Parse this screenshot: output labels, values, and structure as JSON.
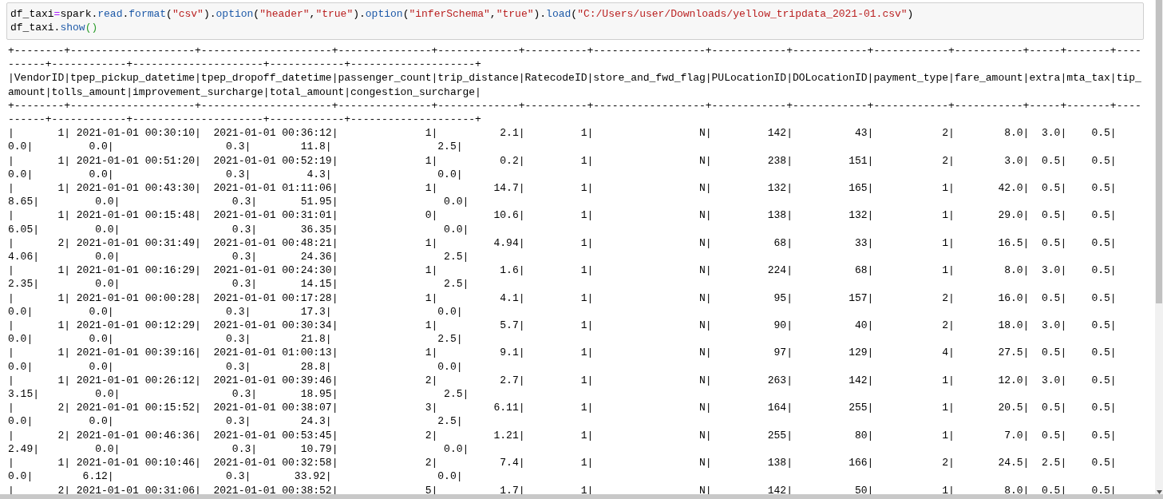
{
  "code": {
    "lines": [
      [
        {
          "kind": "variable",
          "text": "df_taxi"
        },
        {
          "kind": "operator",
          "text": "="
        },
        {
          "kind": "variable",
          "text": "spark"
        },
        {
          "kind": "punct",
          "text": "."
        },
        {
          "kind": "property",
          "text": "read"
        },
        {
          "kind": "punct",
          "text": "."
        },
        {
          "kind": "property",
          "text": "format"
        },
        {
          "kind": "punct",
          "text": "("
        },
        {
          "kind": "string",
          "text": "\"csv\""
        },
        {
          "kind": "punct",
          "text": ")."
        },
        {
          "kind": "property",
          "text": "option"
        },
        {
          "kind": "punct",
          "text": "("
        },
        {
          "kind": "string",
          "text": "\"header\""
        },
        {
          "kind": "punct",
          "text": ","
        },
        {
          "kind": "string",
          "text": "\"true\""
        },
        {
          "kind": "punct",
          "text": ")."
        },
        {
          "kind": "property",
          "text": "option"
        },
        {
          "kind": "punct",
          "text": "("
        },
        {
          "kind": "string",
          "text": "\"inferSchema\""
        },
        {
          "kind": "punct",
          "text": ","
        },
        {
          "kind": "string",
          "text": "\"true\""
        },
        {
          "kind": "punct",
          "text": ")."
        },
        {
          "kind": "property",
          "text": "load"
        },
        {
          "kind": "punct",
          "text": "("
        },
        {
          "kind": "string",
          "text": "\"C:/Users/user/Downloads/yellow_tripdata_2021-01.csv\""
        },
        {
          "kind": "punct",
          "text": ")"
        }
      ],
      [
        {
          "kind": "variable",
          "text": "df_taxi"
        },
        {
          "kind": "punct",
          "text": "."
        },
        {
          "kind": "property",
          "text": "show"
        },
        {
          "kind": "bracket",
          "text": "()"
        }
      ]
    ]
  },
  "output": {
    "lines": [
      "+--------+--------------------+---------------------+---------------+-------------+----------+------------------+------------+------------+------------+-----------+-----+-------+----",
      "------+------------+---------------------+------------+--------------------+",
      "|VendorID|tpep_pickup_datetime|tpep_dropoff_datetime|passenger_count|trip_distance|RatecodeID|store_and_fwd_flag|PULocationID|DOLocationID|payment_type|fare_amount|extra|mta_tax|tip_",
      "amount|tolls_amount|improvement_surcharge|total_amount|congestion_surcharge|",
      "+--------+--------------------+---------------------+---------------+-------------+----------+------------------+------------+------------+------------+-----------+-----+-------+----",
      "------+------------+---------------------+------------+--------------------+",
      "|       1| 2021-01-01 00:30:10|  2021-01-01 00:36:12|              1|          2.1|         1|                 N|         142|          43|           2|        8.0|  3.0|    0.5|",
      "0.0|         0.0|                  0.3|        11.8|                 2.5|",
      "|       1| 2021-01-01 00:51:20|  2021-01-01 00:52:19|              1|          0.2|         1|                 N|         238|         151|           2|        3.0|  0.5|    0.5|",
      "0.0|         0.0|                  0.3|         4.3|                 0.0|",
      "|       1| 2021-01-01 00:43:30|  2021-01-01 01:11:06|              1|         14.7|         1|                 N|         132|         165|           1|       42.0|  0.5|    0.5|",
      "8.65|         0.0|                  0.3|       51.95|                 0.0|",
      "|       1| 2021-01-01 00:15:48|  2021-01-01 00:31:01|              0|         10.6|         1|                 N|         138|         132|           1|       29.0|  0.5|    0.5|",
      "6.05|         0.0|                  0.3|       36.35|                 0.0|",
      "|       2| 2021-01-01 00:31:49|  2021-01-01 00:48:21|              1|         4.94|         1|                 N|          68|          33|           1|       16.5|  0.5|    0.5|",
      "4.06|         0.0|                  0.3|       24.36|                 2.5|",
      "|       1| 2021-01-01 00:16:29|  2021-01-01 00:24:30|              1|          1.6|         1|                 N|         224|          68|           1|        8.0|  3.0|    0.5|",
      "2.35|         0.0|                  0.3|       14.15|                 2.5|",
      "|       1| 2021-01-01 00:00:28|  2021-01-01 00:17:28|              1|          4.1|         1|                 N|          95|         157|           2|       16.0|  0.5|    0.5|",
      "0.0|         0.0|                  0.3|        17.3|                 0.0|",
      "|       1| 2021-01-01 00:12:29|  2021-01-01 00:30:34|              1|          5.7|         1|                 N|          90|          40|           2|       18.0|  3.0|    0.5|",
      "0.0|         0.0|                  0.3|        21.8|                 2.5|",
      "|       1| 2021-01-01 00:39:16|  2021-01-01 01:00:13|              1|          9.1|         1|                 N|          97|         129|           4|       27.5|  0.5|    0.5|",
      "0.0|         0.0|                  0.3|        28.8|                 0.0|",
      "|       1| 2021-01-01 00:26:12|  2021-01-01 00:39:46|              2|          2.7|         1|                 N|         263|         142|           1|       12.0|  3.0|    0.5|",
      "3.15|         0.0|                  0.3|       18.95|                 2.5|",
      "|       2| 2021-01-01 00:15:52|  2021-01-01 00:38:07|              3|         6.11|         1|                 N|         164|         255|           1|       20.5|  0.5|    0.5|",
      "0.0|         0.0|                  0.3|        24.3|                 2.5|",
      "|       2| 2021-01-01 00:46:36|  2021-01-01 00:53:45|              2|         1.21|         1|                 N|         255|          80|           1|        7.0|  0.5|    0.5|",
      "2.49|         0.0|                  0.3|       10.79|                 0.0|",
      "|       1| 2021-01-01 00:10:46|  2021-01-01 00:32:58|              2|          7.4|         1|                 N|         138|         166|           2|       24.5|  2.5|    0.5|",
      "0.0|        6.12|                  0.3|       33.92|                 0.0|",
      "|       2| 2021-01-01 00:31:06|  2021-01-01 00:38:52|              5|          1.7|         1|                 N|         142|          50|           1|        8.0|  0.5|    0.5|"
    ]
  }
}
